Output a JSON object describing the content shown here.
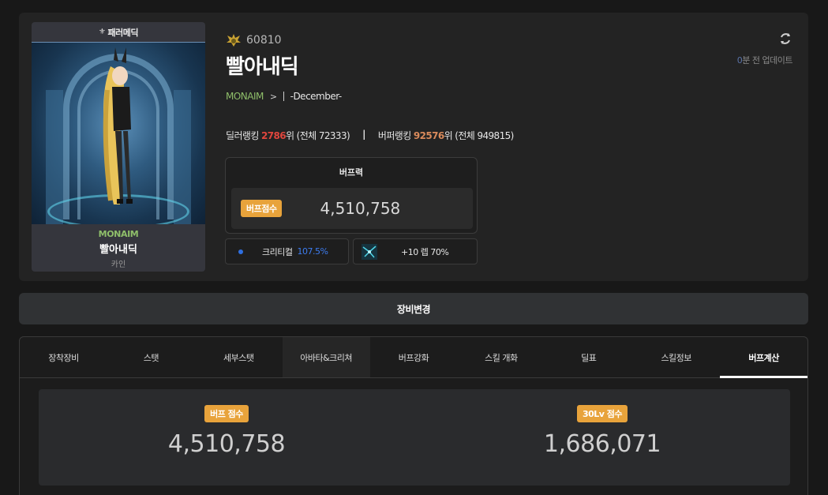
{
  "character": {
    "badge_label": "패러메딕",
    "guild": "MONAIM",
    "name": "빨아내딕",
    "class": "카인",
    "fame": "60810",
    "adventure_name": "-December-"
  },
  "ranking": {
    "dealer_label": "딜러랭킹",
    "dealer_rank": "2786",
    "dealer_suffix": "위 (전체 72333)",
    "buffer_label": "버퍼랭킹",
    "buffer_rank": "92576",
    "buffer_suffix": "위 (전체 949815)",
    "divider": "|"
  },
  "refresh": {
    "count": "0",
    "text": "분 전 업데이트"
  },
  "buff_power": {
    "title": "버프력",
    "badge": "버프점수",
    "value": "4,510,758"
  },
  "stats": {
    "crit_label": "크리티컬",
    "crit_value": "107.5%",
    "level_text": "+10 렙 70%"
  },
  "equip_change_label": "장비변경",
  "tabs": [
    {
      "label": "장착장비"
    },
    {
      "label": "스탯"
    },
    {
      "label": "세부스탯"
    },
    {
      "label": "아바타&크리쳐"
    },
    {
      "label": "버프강화"
    },
    {
      "label": "스킬 개화"
    },
    {
      "label": "딜표"
    },
    {
      "label": "스킬정보"
    },
    {
      "label": "버프계산"
    }
  ],
  "scores": {
    "buff_badge": "버프 점수",
    "buff_value": "4,510,758",
    "lv30_badge": "30Lv 점수",
    "lv30_value": "1,686,071"
  },
  "colors": {
    "accent_orange": "#e8a33b",
    "dealer_rank": "#e0463d",
    "buffer_rank": "#d98a5b",
    "guild_green": "#8fbf6a",
    "crit_blue": "#3d7cf0"
  }
}
